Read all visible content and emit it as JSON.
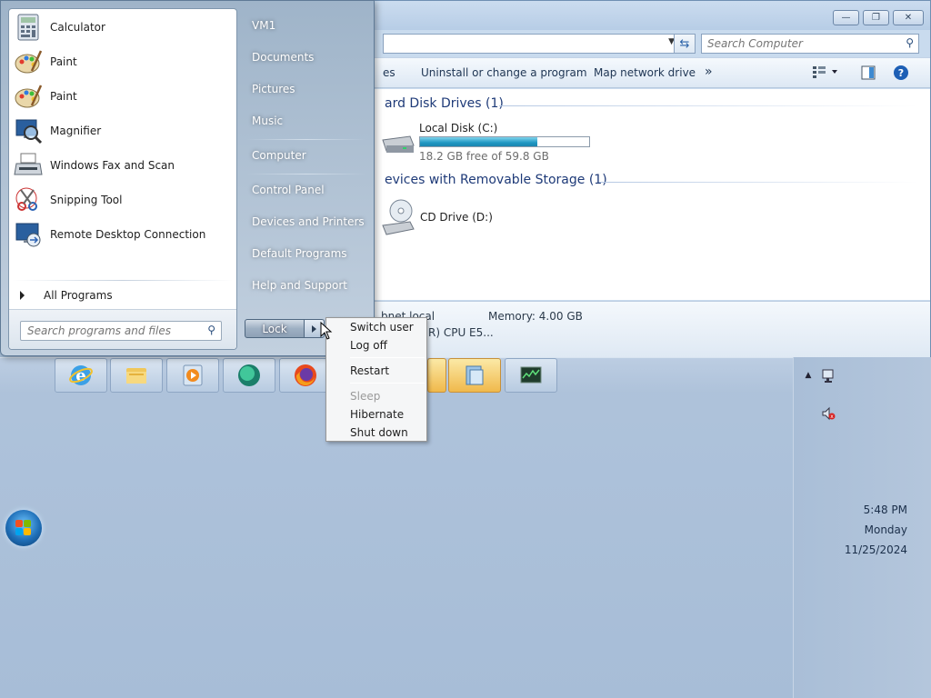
{
  "start_menu": {
    "programs": [
      {
        "label": "Calculator",
        "icon": "calculator-icon"
      },
      {
        "label": "Paint",
        "icon": "paint-palette-icon"
      },
      {
        "label": "Paint",
        "icon": "paint-palette-icon"
      },
      {
        "label": "Magnifier",
        "icon": "magnifier-icon"
      },
      {
        "label": "Windows Fax and Scan",
        "icon": "fax-scanner-icon"
      },
      {
        "label": "Snipping Tool",
        "icon": "scissors-icon"
      },
      {
        "label": "Remote Desktop Connection",
        "icon": "remote-desktop-icon"
      }
    ],
    "all_programs": "All Programs",
    "search_placeholder": "Search programs and files",
    "right_items": [
      "VM1",
      "Documents",
      "Pictures",
      "Music",
      "Computer",
      "Control Panel",
      "Devices and Printers",
      "Default Programs",
      "Help and Support"
    ],
    "lock_label": "Lock"
  },
  "power_menu": {
    "switch_user": "Switch user",
    "log_off": "Log off",
    "restart": "Restart",
    "sleep": "Sleep",
    "hibernate": "Hibernate",
    "shut_down": "Shut down"
  },
  "explorer": {
    "search_placeholder": "Search Computer",
    "commands": {
      "partial": "es",
      "uninstall": "Uninstall or change a program",
      "map_drive": "Map network drive",
      "more": "»"
    },
    "groups": {
      "hdd_heading": "ard Disk Drives (1)",
      "removable_heading": "evices with Removable Storage (1)"
    },
    "local_disk": {
      "label": "Local Disk (C:)",
      "free_text": "18.2 GB free of 59.8 GB",
      "used_fraction": 0.696
    },
    "cd_drive": {
      "label": "CD Drive (D:)"
    },
    "details": {
      "domain_text": "bnet.local",
      "memory_text": "Memory: 4.00 GB",
      "cpu_text": "R) CPU E5..."
    }
  },
  "clock": {
    "time": "5:48 PM",
    "day": "Monday",
    "date": "11/25/2024"
  },
  "colors": {
    "accent": "#2aa3c9",
    "menu_text": "#1e1e1e",
    "group_heading": "#1e3a78"
  }
}
